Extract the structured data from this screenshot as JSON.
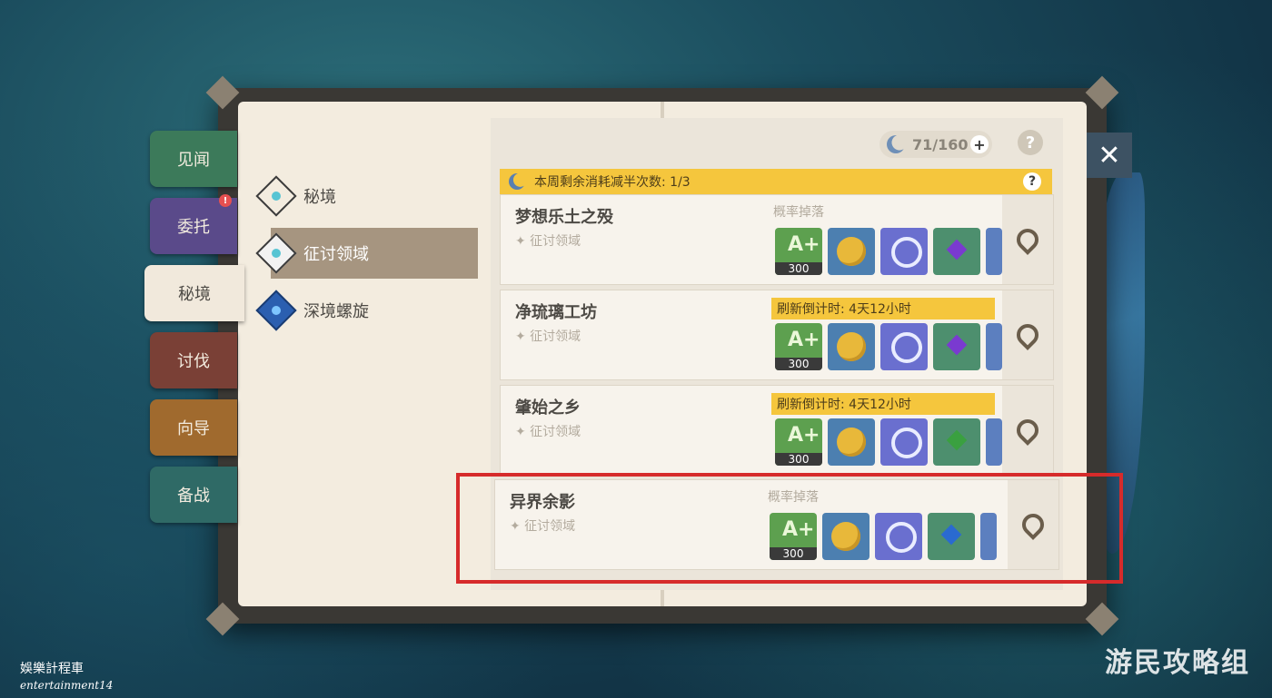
{
  "tabs": [
    {
      "label": "见闻",
      "color": "#3c7a5a"
    },
    {
      "label": "委托",
      "color": "#5a4a8a",
      "badge": "!"
    },
    {
      "label": "秘境",
      "active": true
    },
    {
      "label": "讨伐",
      "color": "#7a4036"
    },
    {
      "label": "向导",
      "color": "#a06a2e"
    },
    {
      "label": "备战",
      "color": "#2f6a66"
    }
  ],
  "categories": [
    {
      "label": "秘境"
    },
    {
      "label": "征讨领域",
      "selected": true
    },
    {
      "label": "深境螺旋"
    }
  ],
  "resin": {
    "value": "71/160",
    "plus": "+"
  },
  "help": "?",
  "close": "✕",
  "banner": {
    "text": "本周剩余消耗减半次数: 1/3",
    "help": "?"
  },
  "domains": [
    {
      "name": "梦想乐土之殁",
      "sub": "✦ 征讨领域",
      "top_label": "概率掉落",
      "refresh": false,
      "exp": "300",
      "mat_color": "#7a3ad0"
    },
    {
      "name": "净琉璃工坊",
      "sub": "✦ 征讨领域",
      "top_label": "刷新倒计时: 4天12小时",
      "refresh": true,
      "exp": "300",
      "mat_color": "#7a3ad0"
    },
    {
      "name": "肇始之乡",
      "sub": "✦ 征讨领域",
      "top_label": "刷新倒计时: 4天12小时",
      "refresh": true,
      "exp": "300",
      "mat_color": "#3aa040"
    },
    {
      "name": "异界余影",
      "sub": "✦ 征讨领域",
      "top_label": "概率掉落",
      "refresh": false,
      "exp": "300",
      "mat_color": "#2a6ad0"
    }
  ],
  "watermark_left": {
    "line1": "娛樂計程車",
    "line2": "entertainment14"
  },
  "watermark_right": "游民攻略组",
  "colors": {
    "highlight": "#d62b2b",
    "banner": "#f5c63d",
    "selected_category": "#a69580"
  }
}
